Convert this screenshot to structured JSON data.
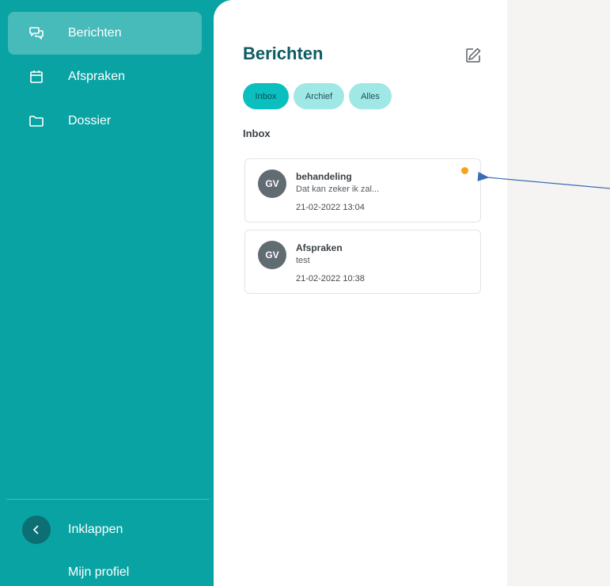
{
  "sidebar": {
    "items": [
      {
        "label": "Berichten",
        "icon": "chat-icon",
        "active": true
      },
      {
        "label": "Afspraken",
        "icon": "calendar-icon",
        "active": false
      },
      {
        "label": "Dossier",
        "icon": "folder-icon",
        "active": false
      }
    ],
    "collapse_label": "Inklappen",
    "profile_label": "Mijn profiel"
  },
  "main": {
    "title": "Berichten",
    "compose_icon": "compose-icon",
    "tabs": [
      {
        "label": "Inbox",
        "active": true
      },
      {
        "label": "Archief",
        "active": false
      },
      {
        "label": "Alles",
        "active": false
      }
    ],
    "section_label": "Inbox",
    "messages": [
      {
        "initials": "GV",
        "subject": "behandeling",
        "preview": "Dat kan zeker ik zal...",
        "time": "21-02-2022 13:04",
        "unread": true
      },
      {
        "initials": "GV",
        "subject": "Afspraken",
        "preview": "test",
        "time": "21-02-2022 10:38",
        "unread": false
      }
    ]
  },
  "colors": {
    "sidebar": "#0aa3a3",
    "accent_dark": "#0d5c63",
    "unread_dot": "#f3a41a",
    "annotation_arrow": "#3d6bb5"
  }
}
